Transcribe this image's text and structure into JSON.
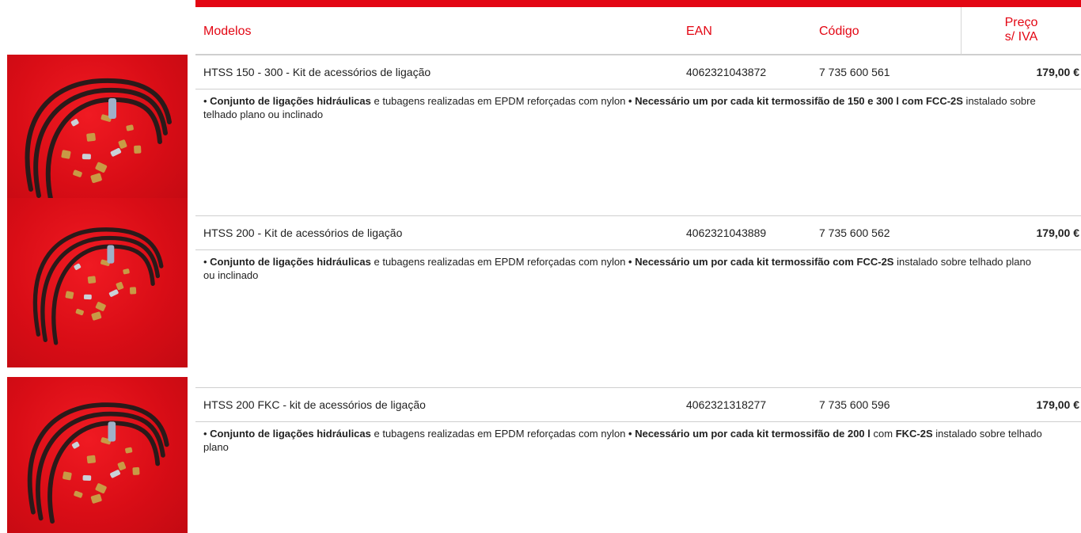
{
  "header": {
    "models": "Modelos",
    "ean": "EAN",
    "code": "Código",
    "price_line1": "Preço",
    "price_line2": "s/ IVA"
  },
  "products": [
    {
      "name": "HTSS 150 - 300 - Kit de acessórios de ligação",
      "ean": "4062321043872",
      "code": "7 735 600 561",
      "price": "179,00 €",
      "desc": [
        {
          "t": "• ",
          "b": false
        },
        {
          "t": "Conjunto de ligações hidráulicas",
          "b": true
        },
        {
          "t": " e tubagens realizadas em EPDM reforçadas com nylon ",
          "b": false
        },
        {
          "t": "• Necessário um por cada kit termossifão de 150 e 300 l com FCC-2S",
          "b": true
        },
        {
          "t": " instalado sobre telhado plano ou inclinado",
          "b": false
        }
      ]
    },
    {
      "name": "HTSS 200 - Kit de acessórios de ligação",
      "ean": "4062321043889",
      "code": "7 735 600 562",
      "price": "179,00 €",
      "desc": [
        {
          "t": "• ",
          "b": false
        },
        {
          "t": "Conjunto de ligações hidráulicas",
          "b": true
        },
        {
          "t": " e tubagens realizadas em EPDM reforçadas com nylon ",
          "b": false
        },
        {
          "t": "• Necessário um por cada kit termossifão com FCC-2S",
          "b": true
        },
        {
          "t": " instalado sobre telhado plano ou inclinado",
          "b": false
        }
      ]
    },
    {
      "name": "HTSS 200 FKC - kit de acessórios de ligação",
      "ean": "4062321318277",
      "code": "7 735 600 596",
      "price": "179,00 €",
      "desc": [
        {
          "t": "• ",
          "b": false
        },
        {
          "t": "Conjunto de ligações hidráulicas",
          "b": true
        },
        {
          "t": " e tubagens realizadas em EPDM reforçadas com nylon ",
          "b": false
        },
        {
          "t": "• Necessário um por cada kit termossifão de 200 l",
          "b": true
        },
        {
          "t": " com ",
          "b": false
        },
        {
          "t": "FKC-2S",
          "b": true
        },
        {
          "t": " instalado sobre telhado plano",
          "b": false
        }
      ]
    }
  ],
  "colors": {
    "accent": "#e30613"
  }
}
